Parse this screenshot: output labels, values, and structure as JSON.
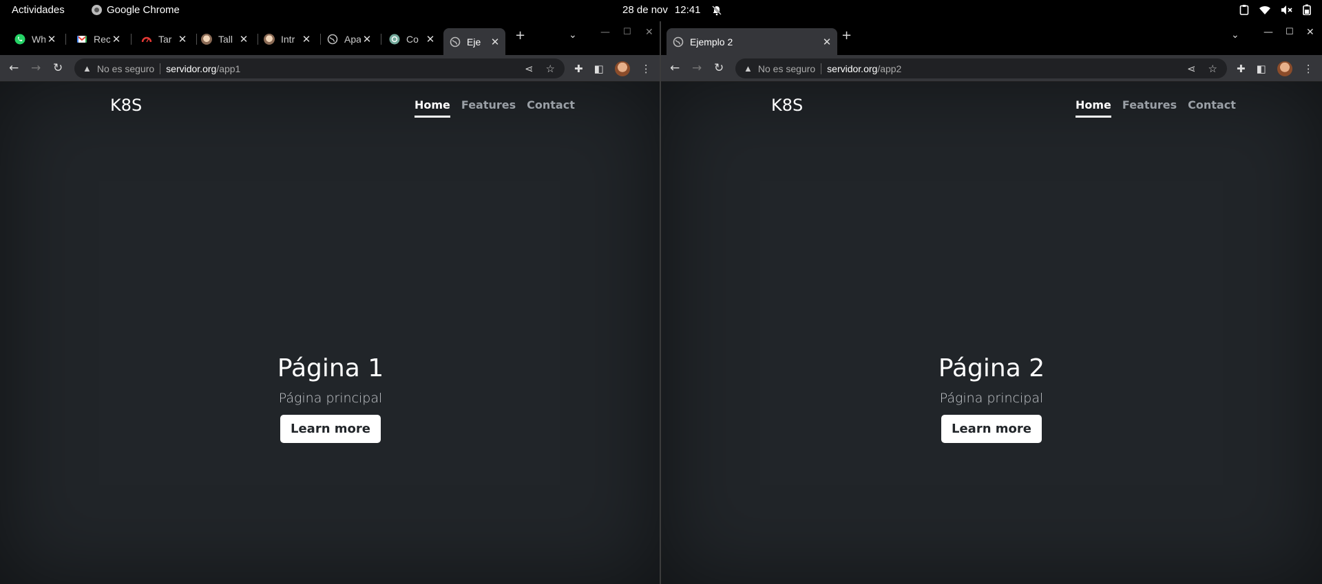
{
  "topbar": {
    "activities": "Actividades",
    "app_name": "Google Chrome",
    "date": "28 de nov",
    "time": "12:41"
  },
  "left_window": {
    "tabs": [
      {
        "title": "Wh",
        "icon": "whatsapp-icon",
        "color": "#25d366"
      },
      {
        "title": "Rec",
        "icon": "gmail-icon",
        "color": "#ea4335"
      },
      {
        "title": "Tar",
        "icon": "gauge-icon",
        "color": "#e53935"
      },
      {
        "title": "Tall",
        "icon": "avatar-icon",
        "color": "#c9a27a"
      },
      {
        "title": "Intr",
        "icon": "avatar-icon",
        "color": "#c9a27a"
      },
      {
        "title": "Apa",
        "icon": "globe-icon",
        "color": "#9aa0a6"
      },
      {
        "title": "Co",
        "icon": "chatgpt-icon",
        "color": "#74aa9c"
      },
      {
        "title": "Eje",
        "icon": "globe-icon",
        "color": "#9aa0a6",
        "active": true
      }
    ],
    "security": "No es seguro",
    "url_host": "servidor.org",
    "url_path": "/app1",
    "page": {
      "brand": "K8S",
      "nav": [
        "Home",
        "Features",
        "Contact"
      ],
      "heading": "Página 1",
      "lead": "Página principal",
      "button": "Learn more"
    }
  },
  "right_window": {
    "tabs": [
      {
        "title": "Ejemplo 2",
        "icon": "globe-icon",
        "color": "#9aa0a6",
        "active": true
      }
    ],
    "security": "No es seguro",
    "url_host": "servidor.org",
    "url_path": "/app2",
    "page": {
      "brand": "K8S",
      "nav": [
        "Home",
        "Features",
        "Contact"
      ],
      "heading": "Página 2",
      "lead": "Página principal",
      "button": "Learn more"
    }
  }
}
